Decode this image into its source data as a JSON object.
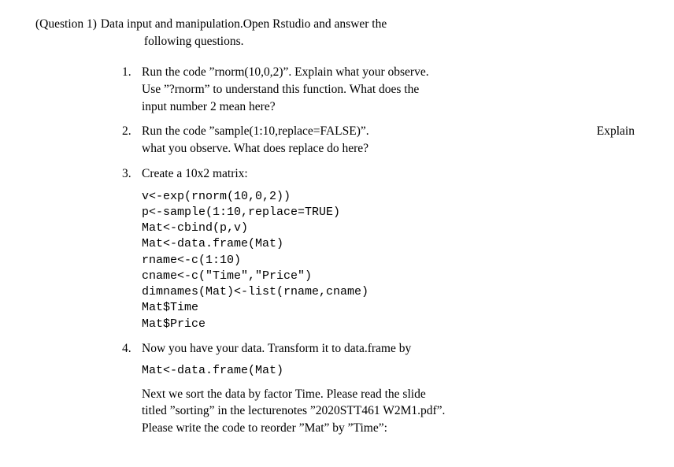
{
  "header": {
    "label": "(Question 1)",
    "intro1": "Data input and manipulation.Open Rstudio and answer the",
    "intro2": "following questions."
  },
  "items": {
    "one": {
      "num": "1.",
      "line1": "Run the code ”rnorm(10,0,2)”. Explain what your observe.",
      "line2": "Use ”?rnorm” to understand this function. What does the",
      "line3": "input number 2 mean here?"
    },
    "two": {
      "num": "2.",
      "part_a": "Run the code ”sample(1:10,replace=FALSE)”.",
      "part_b": "Explain",
      "line2": "what you observe. What does replace do here?"
    },
    "three": {
      "num": "3.",
      "text": "Create a 10x2 matrix:",
      "code": "v<-exp(rnorm(10,0,2))\np<-sample(1:10,replace=TRUE)\nMat<-cbind(p,v)\nMat<-data.frame(Mat)\nrname<-c(1:10)\ncname<-c(\"Time\",\"Price\")\ndimnames(Mat)<-list(rname,cname)\nMat$Time\nMat$Price"
    },
    "four": {
      "num": "4.",
      "text1": "Now you have your data. Transform it to data.frame by",
      "code": "Mat<-data.frame(Mat)",
      "after1": "Next we sort the data by factor Time. Please read the slide",
      "after2": "titled ”sorting” in the lecturenotes ”2020STT461 W2M1.pdf”.",
      "after3": "Please write the code to reorder ”Mat” by ”Time”:"
    }
  }
}
